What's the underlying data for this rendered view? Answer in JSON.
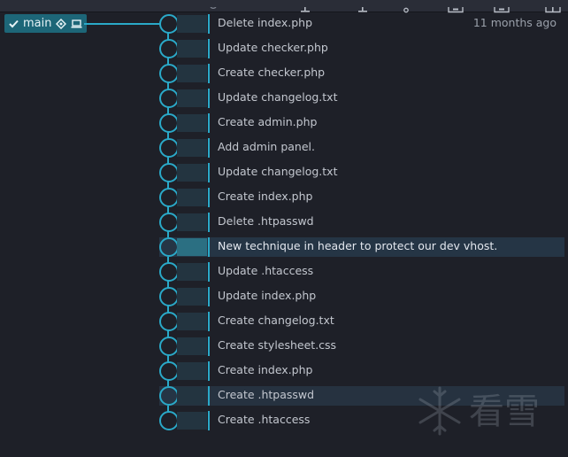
{
  "branch": {
    "name": "main",
    "icons": [
      "check-icon",
      "target-icon",
      "laptop-icon"
    ]
  },
  "commits": [
    {
      "message": "Delete index.php",
      "date": "11 months ago"
    },
    {
      "message": "Update checker.php"
    },
    {
      "message": "Create checker.php"
    },
    {
      "message": "Update changelog.txt"
    },
    {
      "message": "Create admin.php"
    },
    {
      "message": "Add admin panel."
    },
    {
      "message": "Update changelog.txt"
    },
    {
      "message": "Create index.php"
    },
    {
      "message": "Delete .htpasswd"
    },
    {
      "message": "New technique in header to protect our dev vhost.",
      "selected": true
    },
    {
      "message": "Update .htaccess"
    },
    {
      "message": "Update index.php"
    },
    {
      "message": "Create changelog.txt"
    },
    {
      "message": "Create stylesheet.css"
    },
    {
      "message": "Create index.php"
    },
    {
      "message": "Create .htpasswd",
      "hovered": true
    },
    {
      "message": "Create .htaccess"
    }
  ],
  "watermark": {
    "text": "看雪"
  },
  "colors": {
    "accent": "#2aa9c8",
    "branch_bg": "#1d6678",
    "background": "#1e2028"
  }
}
